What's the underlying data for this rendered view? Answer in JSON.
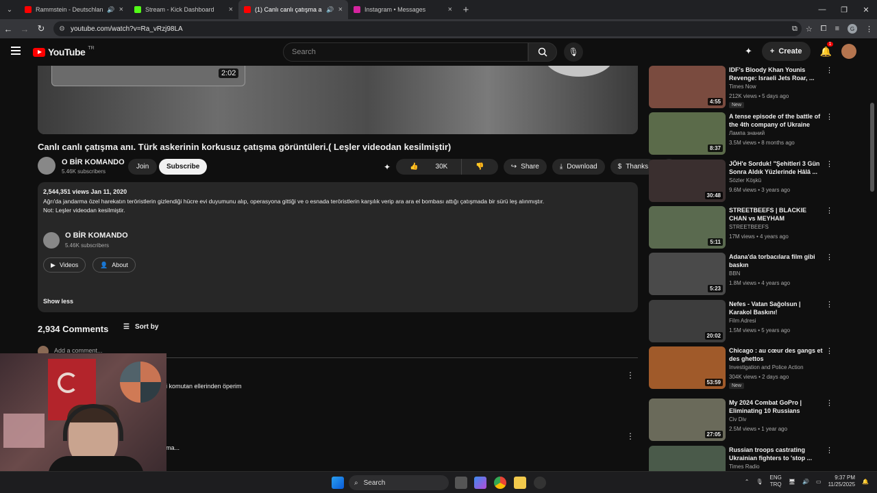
{
  "browser": {
    "tabs": [
      {
        "title": "Rammstein - Deutschland (",
        "fav": "#ff0000"
      },
      {
        "title": "Stream - Kick Dashboard",
        "fav": "#53fc18"
      },
      {
        "title": "(1) Canlı canlı çatışma anı. T",
        "fav": "#ff0000"
      },
      {
        "title": "Instagram • Messages",
        "fav": "#d6249f"
      }
    ],
    "url": "youtube.com/watch?v=Ra_vRzj98LA"
  },
  "yt": {
    "logo_text": "YouTube",
    "country": "TR",
    "search_placeholder": "Search",
    "create_label": "Create",
    "notif_count": "1"
  },
  "video": {
    "overlay_duration": "2:02",
    "title": "Canlı canlı çatışma anı. Türk askerinin korkusuz çatışma görüntüleri.( Leşler videodan kesilmiştir)",
    "channel": "O BİR KOMANDO",
    "subs": "5.46K subscribers",
    "join": "Join",
    "subscribe": "Subscribe",
    "likes": "30K",
    "share": "Share",
    "download": "Download",
    "thanks": "Thanks"
  },
  "description": {
    "meta": "2,544,351 views  Jan 11, 2020",
    "line1": "Ağrı'da jandarma özel harekatın teröristlerin gizlendiği hücre evi duyumunu alıp, operasyona gittiği ve o esnada teröristlerin karşılık verip ara ara el bombası attığı çatışmada bir sürü leş alınmıştır.",
    "line2": "Not: Leşler videodan kesilmiştir.",
    "channel": "O BİR KOMANDO",
    "subs": "5.46K subscribers",
    "videos": "Videos",
    "about": "About",
    "show_less": "Show less"
  },
  "comments": {
    "count": "2,934 Comments",
    "sort": "Sort by",
    "add": "Add a comment...",
    "c1": "i komutan ellerinden öperim",
    "c2": "ma..."
  },
  "sidebar": [
    {
      "title": "IDF's Bloody Khan Younis Revenge: Israeli Jets Roar, ...",
      "channel": "Times Now",
      "meta": "212K views • 5 days ago",
      "badge": "New",
      "dur": "4:55",
      "color": "#7a4b3f"
    },
    {
      "title": "A tense episode of the battle of the 4th company of Ukraine",
      "channel": "Лампа знаний",
      "meta": "3.5M views • 8 months ago",
      "badge": "",
      "dur": "8:37",
      "color": "#5b6b4a"
    },
    {
      "title": "JÖH'e Sorduk! \"Şehitleri 3 Gün Sonra Aldık Yüzlerinde Hâlâ ...",
      "channel": "Sözler Köşkü",
      "meta": "9.6M views • 3 years ago",
      "badge": "",
      "dur": "30:48",
      "color": "#3a2f2f"
    },
    {
      "title": "STREETBEEFS | BLACKIE CHAN vs MEYHAM",
      "channel": "STREETBEEFS",
      "meta": "17M views • 4 years ago",
      "badge": "",
      "dur": "5:11",
      "color": "#5a6a4f"
    },
    {
      "title": "Adana'da torbacılara film gibi baskın",
      "channel": "BBN",
      "meta": "1.8M views • 4 years ago",
      "badge": "",
      "dur": "5:23",
      "color": "#4a4a4a"
    },
    {
      "title": "Nefes - Vatan Sağolsun | Karakol Baskını!",
      "channel": "Film Adresi",
      "meta": "1.5M views • 5 years ago",
      "badge": "",
      "dur": "20:02",
      "color": "#3d3d3d"
    },
    {
      "title": "Chicago : au cœur des gangs et des ghettos",
      "channel": "Investigation  and Police Action",
      "meta": "304K views • 2 days ago",
      "badge": "New",
      "dur": "53:59",
      "color": "#a05a2a"
    },
    {
      "title": "My 2024 Combat GoPro | Eliminating 10 Russians",
      "channel": "Civ Div",
      "meta": "2.5M views • 1 year ago",
      "badge": "",
      "dur": "27:05",
      "color": "#6a6a5a"
    },
    {
      "title": "Russian troops castrating Ukrainian fighters to 'stop ...",
      "channel": "Times Radio",
      "meta": "",
      "badge": "",
      "dur": "",
      "color": "#4a5a4a"
    }
  ],
  "taskbar": {
    "search": "Search",
    "lang1": "ENG",
    "lang2": "TRQ",
    "time": "9:37 PM",
    "date": "11/25/2025"
  }
}
